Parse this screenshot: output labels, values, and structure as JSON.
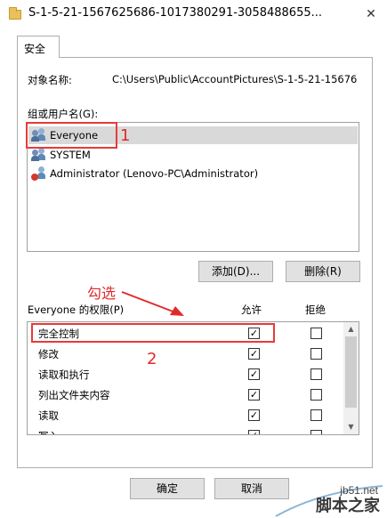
{
  "window": {
    "title": "S-1-5-21-1567625686-1017380291-3058488655..."
  },
  "tabs": [
    {
      "label": "安全"
    }
  ],
  "object": {
    "label": "对象名称:",
    "value": "C:\\Users\\Public\\AccountPictures\\S-1-5-21-15676"
  },
  "groups": {
    "label": "组或用户名(G):",
    "items": [
      {
        "label": "Everyone",
        "selected": true
      },
      {
        "label": "SYSTEM",
        "selected": false
      },
      {
        "label": "Administrator (Lenovo-PC\\Administrator)",
        "selected": false
      }
    ],
    "add_button": "添加(D)...",
    "remove_button": "删除(R)"
  },
  "permissions": {
    "label": "Everyone 的权限(P)",
    "allow_header": "允许",
    "deny_header": "拒绝",
    "rows": [
      {
        "name": "完全控制",
        "allow": true,
        "deny": false
      },
      {
        "name": "修改",
        "allow": true,
        "deny": false
      },
      {
        "name": "读取和执行",
        "allow": true,
        "deny": false
      },
      {
        "name": "列出文件夹内容",
        "allow": true,
        "deny": false
      },
      {
        "name": "读取",
        "allow": true,
        "deny": false
      },
      {
        "name": "写入",
        "allow": true,
        "deny": false
      }
    ]
  },
  "footer": {
    "ok_button": "确定",
    "cancel_button": "取消"
  },
  "annotations": {
    "step1": "1",
    "step2": "2",
    "check_hint": "勾选",
    "color": "#e02b2b"
  },
  "watermark": {
    "url": "jb51.net",
    "name": "脚本之家"
  }
}
